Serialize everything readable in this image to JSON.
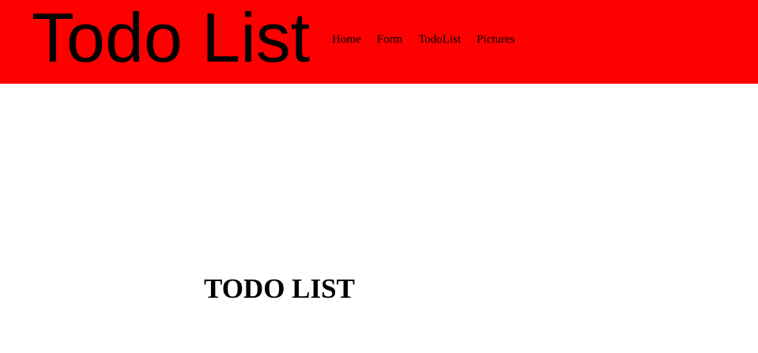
{
  "header": {
    "brand_title": "Todo List",
    "background_color": "#ff0000",
    "nav": [
      {
        "label": "Home"
      },
      {
        "label": "Form"
      },
      {
        "label": "TodoList"
      },
      {
        "label": "Pictures"
      }
    ]
  },
  "main": {
    "heading": "TODO LIST"
  }
}
